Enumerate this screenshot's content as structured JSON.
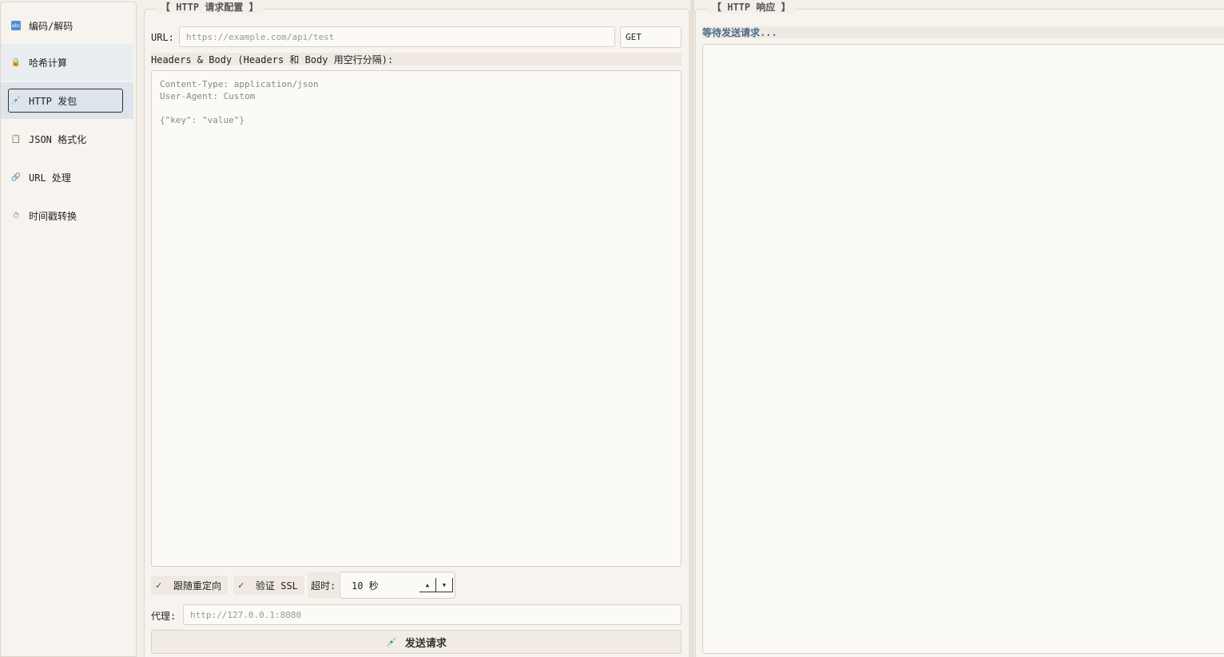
{
  "sidebar": {
    "items": [
      {
        "label": "编码/解码",
        "icon": "abc-icon"
      },
      {
        "label": "哈希计算",
        "icon": "lock-icon"
      },
      {
        "label": "HTTP 发包",
        "icon": "syringe-icon"
      },
      {
        "label": "JSON 格式化",
        "icon": "clipboard-icon"
      },
      {
        "label": "URL 处理",
        "icon": "link-icon"
      },
      {
        "label": "时间戳转换",
        "icon": "timer-icon"
      }
    ]
  },
  "request": {
    "title": "【 HTTP 请求配置 】",
    "url_label": "URL:",
    "url_placeholder": "https://example.com/api/test",
    "method": "GET",
    "headers_label": "Headers & Body (Headers 和 Body 用空行分隔):",
    "headers_placeholder": "Content-Type: application/json\nUser-Agent: Custom\n\n{\"key\": \"value\"}",
    "follow_redirect": "跟随重定向",
    "verify_ssl": "验证 SSL",
    "timeout_label": "超时:",
    "timeout_value": "10 秒",
    "proxy_label": "代理:",
    "proxy_placeholder": "http://127.0.0.1:8080",
    "send_button": "发送请求"
  },
  "response": {
    "title": "【 HTTP 响应 】",
    "status": "等待发送请求..."
  }
}
